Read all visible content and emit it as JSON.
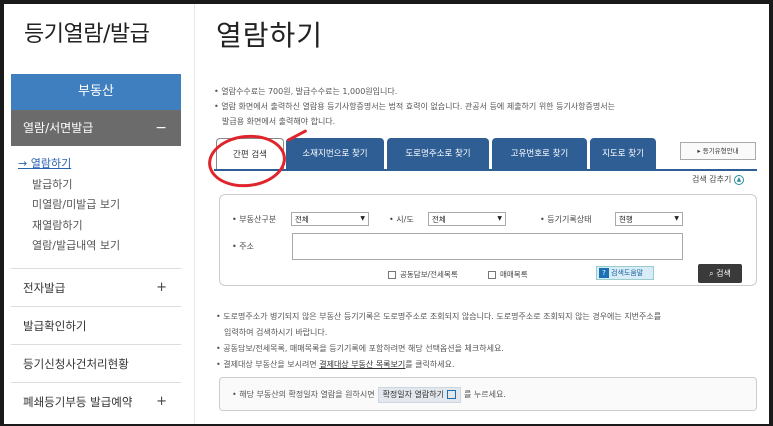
{
  "sidebar": {
    "title": "등기열람/발급",
    "header": "부동산",
    "active_menu": {
      "label": "열람/서면발급",
      "toggle": "−"
    },
    "sub_items": [
      {
        "label": "열람하기",
        "active": true
      },
      {
        "label": "발급하기",
        "active": false
      },
      {
        "label": "미열람/미발급 보기",
        "active": false
      },
      {
        "label": "재열람하기",
        "active": false
      },
      {
        "label": "열람/발급내역 보기",
        "active": false
      }
    ],
    "menus": [
      {
        "label": "전자발급",
        "toggle": "+"
      },
      {
        "label": "발급확인하기",
        "toggle": ""
      },
      {
        "label": "등기신청사건처리현황",
        "toggle": ""
      },
      {
        "label": "폐쇄등기부등 발급예약",
        "toggle": "+"
      }
    ]
  },
  "main": {
    "title": "열람하기",
    "notes": [
      "열람수수료는 700원, 발급수수료는 1,000원입니다.",
      "열람 화면에서 출력하신 열람용 등기사항증명서는 법적 효력이 없습니다. 관공서 등에 제출하기 위한 등기사항증명서는",
      "발급용 화면에서 출력해야 합니다."
    ],
    "tabs": [
      "간편 검색",
      "소재지번으로 찾기",
      "도로명주소로 찾기",
      "고유번호로 찾기",
      "지도로 찾기"
    ],
    "guide_button": "등기유형안내",
    "hide_search": "검색 감추기",
    "form": {
      "property_label": "부동산구분",
      "property_value": "전체",
      "city_label": "시/도",
      "city_value": "전체",
      "status_label": "등기기록상태",
      "status_value": "현행",
      "address_label": "주소",
      "address_value": "",
      "check1": "공동담보/전세목록",
      "check2": "매매목록",
      "help_label": "검색도움말",
      "search_label": "검색"
    },
    "bottom_notes": [
      "도로명주소가 병기되지 않은 부동산 등기기록은 도로명주소로 조회되지 않습니다. 도로명주소로 조회되지 않는 경우에는 지번주소를",
      "입력하여 검색하시기 바랍니다.",
      "공동담보/전세목록, 매매목록을 등기기록에 포함하려면 해당 선택옵션을 체크하세요.",
      "결제대상 부동산을 보시려면",
      "결제대상 부동산 목록보기",
      "를 클릭하세요."
    ],
    "info": {
      "prefix": "해당 부동산의 확정일자 열람을 원하시면",
      "button": "확정일자 열람하기",
      "suffix": "를 누르세요."
    }
  }
}
